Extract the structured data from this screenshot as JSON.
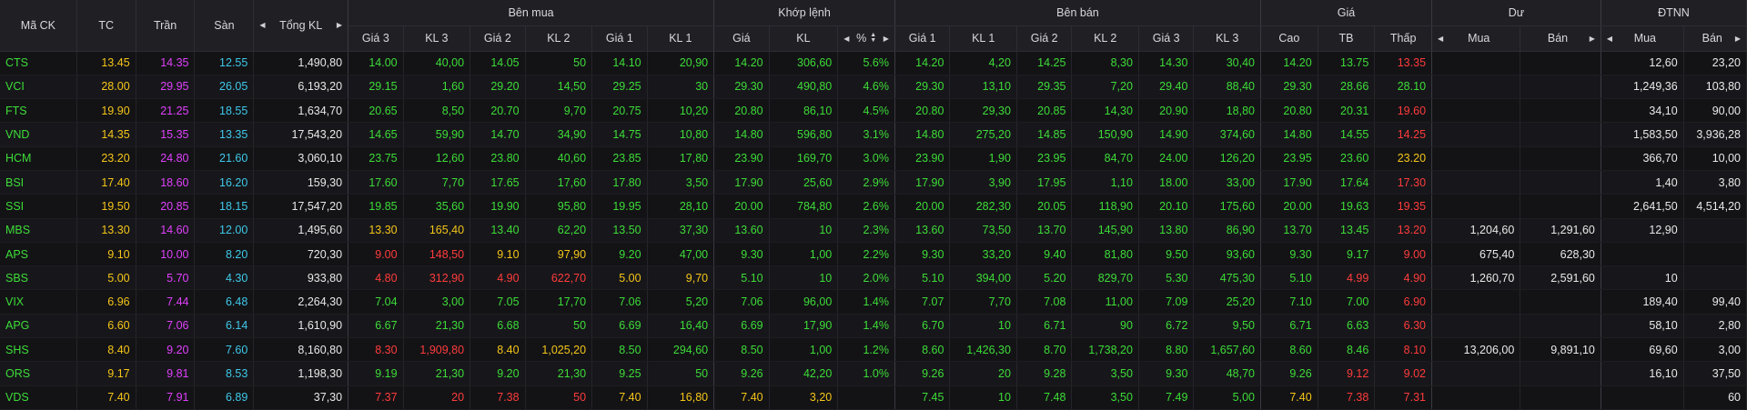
{
  "headers": {
    "symbol": "Mã CK",
    "ref": "TC",
    "ceil": "Trần",
    "floor": "Sàn",
    "total": "Tổng KL",
    "buy_group": "Bên mua",
    "match_group": "Khớp lệnh",
    "sell_group": "Bên bán",
    "price_group": "Giá",
    "residual_group": "Dư",
    "foreign_group": "ĐTNN",
    "gia3": "Giá 3",
    "kl3": "KL 3",
    "gia2": "Giá 2",
    "kl2": "KL 2",
    "gia1": "Giá 1",
    "kl1": "KL 1",
    "m_gia": "Giá",
    "m_kl": "KL",
    "m_pct": "%",
    "s_gia1": "Giá 1",
    "s_kl1": "KL 1",
    "s_gia2": "Giá 2",
    "s_kl2": "KL 2",
    "s_gia3": "Giá 3",
    "s_kl3": "KL 3",
    "high": "Cao",
    "avg": "TB",
    "low": "Thấp",
    "r_buy": "Mua",
    "r_sell": "Bán",
    "f_buy": "Mua",
    "f_sell": "Bán"
  },
  "colors": {
    "green": "#3ddc37",
    "yellow": "#f5c518",
    "red": "#ff3b3b",
    "purple": "#e040fb",
    "cyan": "#3ec8e8",
    "white": "#e8e8e8"
  },
  "rows": [
    {
      "sym": "CTS",
      "tc": "13.45",
      "tran": "14.35",
      "san": "12.55",
      "tkl": "1,490,80",
      "b": [
        [
          "14.00",
          "40,00",
          "g"
        ],
        [
          "14.05",
          "50",
          "g"
        ],
        [
          "14.10",
          "20,90",
          "g"
        ]
      ],
      "m": [
        "14.20",
        "306,60",
        "5.6%",
        "g"
      ],
      "s": [
        [
          "14.20",
          "4,20",
          "g"
        ],
        [
          "14.25",
          "8,30",
          "g"
        ],
        [
          "14.30",
          "30,40",
          "g"
        ]
      ],
      "cao": [
        "14.20",
        "g"
      ],
      "tb": [
        "13.75",
        "g"
      ],
      "thap": [
        "13.35",
        "r"
      ],
      "dmua": "",
      "dban": "",
      "fmua": "12,60",
      "fban": "23,20"
    },
    {
      "sym": "VCI",
      "tc": "28.00",
      "tran": "29.95",
      "san": "26.05",
      "tkl": "6,193,20",
      "b": [
        [
          "29.15",
          "1,60",
          "g"
        ],
        [
          "29.20",
          "14,50",
          "g"
        ],
        [
          "29.25",
          "30",
          "g"
        ]
      ],
      "m": [
        "29.30",
        "490,80",
        "4.6%",
        "g"
      ],
      "s": [
        [
          "29.30",
          "13,10",
          "g"
        ],
        [
          "29.35",
          "7,20",
          "g"
        ],
        [
          "29.40",
          "88,40",
          "g"
        ]
      ],
      "cao": [
        "29.30",
        "g"
      ],
      "tb": [
        "28.66",
        "g"
      ],
      "thap": [
        "28.10",
        "g"
      ],
      "dmua": "",
      "dban": "",
      "fmua": "1,249,36",
      "fban": "103,80"
    },
    {
      "sym": "FTS",
      "tc": "19.90",
      "tran": "21.25",
      "san": "18.55",
      "tkl": "1,634,70",
      "b": [
        [
          "20.65",
          "8,50",
          "g"
        ],
        [
          "20.70",
          "9,70",
          "g"
        ],
        [
          "20.75",
          "10,20",
          "g"
        ]
      ],
      "m": [
        "20.80",
        "86,10",
        "4.5%",
        "g"
      ],
      "s": [
        [
          "20.80",
          "29,30",
          "g"
        ],
        [
          "20.85",
          "14,30",
          "g"
        ],
        [
          "20.90",
          "18,80",
          "g"
        ]
      ],
      "cao": [
        "20.80",
        "g"
      ],
      "tb": [
        "20.31",
        "g"
      ],
      "thap": [
        "19.60",
        "r"
      ],
      "dmua": "",
      "dban": "",
      "fmua": "34,10",
      "fban": "90,00"
    },
    {
      "sym": "VND",
      "tc": "14.35",
      "tran": "15.35",
      "san": "13.35",
      "tkl": "17,543,20",
      "b": [
        [
          "14.65",
          "59,90",
          "g"
        ],
        [
          "14.70",
          "34,90",
          "g"
        ],
        [
          "14.75",
          "10,80",
          "g"
        ]
      ],
      "m": [
        "14.80",
        "596,80",
        "3.1%",
        "g"
      ],
      "s": [
        [
          "14.80",
          "275,20",
          "g"
        ],
        [
          "14.85",
          "150,90",
          "g"
        ],
        [
          "14.90",
          "374,60",
          "g"
        ]
      ],
      "cao": [
        "14.80",
        "g"
      ],
      "tb": [
        "14.55",
        "g"
      ],
      "thap": [
        "14.25",
        "r"
      ],
      "dmua": "",
      "dban": "",
      "fmua": "1,583,50",
      "fban": "3,936,28"
    },
    {
      "sym": "HCM",
      "tc": "23.20",
      "tran": "24.80",
      "san": "21.60",
      "tkl": "3,060,10",
      "b": [
        [
          "23.75",
          "12,60",
          "g"
        ],
        [
          "23.80",
          "40,60",
          "g"
        ],
        [
          "23.85",
          "17,80",
          "g"
        ]
      ],
      "m": [
        "23.90",
        "169,70",
        "3.0%",
        "g"
      ],
      "s": [
        [
          "23.90",
          "1,90",
          "g"
        ],
        [
          "23.95",
          "84,70",
          "g"
        ],
        [
          "24.00",
          "126,20",
          "g"
        ]
      ],
      "cao": [
        "23.95",
        "g"
      ],
      "tb": [
        "23.60",
        "g"
      ],
      "thap": [
        "23.20",
        "y"
      ],
      "dmua": "",
      "dban": "",
      "fmua": "366,70",
      "fban": "10,00"
    },
    {
      "sym": "BSI",
      "tc": "17.40",
      "tran": "18.60",
      "san": "16.20",
      "tkl": "159,30",
      "b": [
        [
          "17.60",
          "7,70",
          "g"
        ],
        [
          "17.65",
          "17,60",
          "g"
        ],
        [
          "17.80",
          "3,50",
          "g"
        ]
      ],
      "m": [
        "17.90",
        "25,60",
        "2.9%",
        "g"
      ],
      "s": [
        [
          "17.90",
          "3,90",
          "g"
        ],
        [
          "17.95",
          "1,10",
          "g"
        ],
        [
          "18.00",
          "33,00",
          "g"
        ]
      ],
      "cao": [
        "17.90",
        "g"
      ],
      "tb": [
        "17.64",
        "g"
      ],
      "thap": [
        "17.30",
        "r"
      ],
      "dmua": "",
      "dban": "",
      "fmua": "1,40",
      "fban": "3,80"
    },
    {
      "sym": "SSI",
      "tc": "19.50",
      "tran": "20.85",
      "san": "18.15",
      "tkl": "17,547,20",
      "b": [
        [
          "19.85",
          "35,60",
          "g"
        ],
        [
          "19.90",
          "95,80",
          "g"
        ],
        [
          "19.95",
          "28,10",
          "g"
        ]
      ],
      "m": [
        "20.00",
        "784,80",
        "2.6%",
        "g"
      ],
      "s": [
        [
          "20.00",
          "282,30",
          "g"
        ],
        [
          "20.05",
          "118,90",
          "g"
        ],
        [
          "20.10",
          "175,60",
          "g"
        ]
      ],
      "cao": [
        "20.00",
        "g"
      ],
      "tb": [
        "19.63",
        "g"
      ],
      "thap": [
        "19.35",
        "r"
      ],
      "dmua": "",
      "dban": "",
      "fmua": "2,641,50",
      "fban": "4,514,20"
    },
    {
      "sym": "MBS",
      "tc": "13.30",
      "tran": "14.60",
      "san": "12.00",
      "tkl": "1,495,60",
      "b": [
        [
          "13.30",
          "165,40",
          "y"
        ],
        [
          "13.40",
          "62,20",
          "g"
        ],
        [
          "13.50",
          "37,30",
          "g"
        ]
      ],
      "m": [
        "13.60",
        "10",
        "2.3%",
        "g"
      ],
      "s": [
        [
          "13.60",
          "73,50",
          "g"
        ],
        [
          "13.70",
          "145,90",
          "g"
        ],
        [
          "13.80",
          "86,90",
          "g"
        ]
      ],
      "cao": [
        "13.70",
        "g"
      ],
      "tb": [
        "13.45",
        "g"
      ],
      "thap": [
        "13.20",
        "r"
      ],
      "dmua": "1,204,60",
      "dban": "1,291,60",
      "fmua": "12,90",
      "fban": ""
    },
    {
      "sym": "APS",
      "tc": "9.10",
      "tran": "10.00",
      "san": "8.20",
      "tkl": "720,30",
      "b": [
        [
          "9.00",
          "148,50",
          "r"
        ],
        [
          "9.10",
          "97,90",
          "y"
        ],
        [
          "9.20",
          "47,00",
          "g"
        ]
      ],
      "m": [
        "9.30",
        "1,00",
        "2.2%",
        "g"
      ],
      "s": [
        [
          "9.30",
          "33,20",
          "g"
        ],
        [
          "9.40",
          "81,80",
          "g"
        ],
        [
          "9.50",
          "93,60",
          "g"
        ]
      ],
      "cao": [
        "9.30",
        "g"
      ],
      "tb": [
        "9.17",
        "g"
      ],
      "thap": [
        "9.00",
        "r"
      ],
      "dmua": "675,40",
      "dban": "628,30",
      "fmua": "",
      "fban": ""
    },
    {
      "sym": "SBS",
      "tc": "5.00",
      "tran": "5.70",
      "san": "4.30",
      "tkl": "933,80",
      "b": [
        [
          "4.80",
          "312,90",
          "r"
        ],
        [
          "4.90",
          "622,70",
          "r"
        ],
        [
          "5.00",
          "9,70",
          "y"
        ]
      ],
      "m": [
        "5.10",
        "10",
        "2.0%",
        "g"
      ],
      "s": [
        [
          "5.10",
          "394,00",
          "g"
        ],
        [
          "5.20",
          "829,70",
          "g"
        ],
        [
          "5.30",
          "475,30",
          "g"
        ]
      ],
      "cao": [
        "5.10",
        "g"
      ],
      "tb": [
        "4.99",
        "r"
      ],
      "thap": [
        "4.90",
        "r"
      ],
      "dmua": "1,260,70",
      "dban": "2,591,60",
      "fmua": "10",
      "fban": ""
    },
    {
      "sym": "VIX",
      "tc": "6.96",
      "tran": "7.44",
      "san": "6.48",
      "tkl": "2,264,30",
      "b": [
        [
          "7.04",
          "3,00",
          "g"
        ],
        [
          "7.05",
          "17,70",
          "g"
        ],
        [
          "7.06",
          "5,20",
          "g"
        ]
      ],
      "m": [
        "7.06",
        "96,00",
        "1.4%",
        "g"
      ],
      "s": [
        [
          "7.07",
          "7,70",
          "g"
        ],
        [
          "7.08",
          "11,00",
          "g"
        ],
        [
          "7.09",
          "25,20",
          "g"
        ]
      ],
      "cao": [
        "7.10",
        "g"
      ],
      "tb": [
        "7.00",
        "g"
      ],
      "thap": [
        "6.90",
        "r"
      ],
      "dmua": "",
      "dban": "",
      "fmua": "189,40",
      "fban": "99,40"
    },
    {
      "sym": "APG",
      "tc": "6.60",
      "tran": "7.06",
      "san": "6.14",
      "tkl": "1,610,90",
      "b": [
        [
          "6.67",
          "21,30",
          "g"
        ],
        [
          "6.68",
          "50",
          "g"
        ],
        [
          "6.69",
          "16,40",
          "g"
        ]
      ],
      "m": [
        "6.69",
        "17,90",
        "1.4%",
        "g"
      ],
      "s": [
        [
          "6.70",
          "10",
          "g"
        ],
        [
          "6.71",
          "90",
          "g"
        ],
        [
          "6.72",
          "9,50",
          "g"
        ]
      ],
      "cao": [
        "6.71",
        "g"
      ],
      "tb": [
        "6.63",
        "g"
      ],
      "thap": [
        "6.30",
        "r"
      ],
      "dmua": "",
      "dban": "",
      "fmua": "58,10",
      "fban": "2,80"
    },
    {
      "sym": "SHS",
      "tc": "8.40",
      "tran": "9.20",
      "san": "7.60",
      "tkl": "8,160,80",
      "b": [
        [
          "8.30",
          "1,909,80",
          "r"
        ],
        [
          "8.40",
          "1,025,20",
          "y"
        ],
        [
          "8.50",
          "294,60",
          "g"
        ]
      ],
      "m": [
        "8.50",
        "1,00",
        "1.2%",
        "g"
      ],
      "s": [
        [
          "8.60",
          "1,426,30",
          "g"
        ],
        [
          "8.70",
          "1,738,20",
          "g"
        ],
        [
          "8.80",
          "1,657,60",
          "g"
        ]
      ],
      "cao": [
        "8.60",
        "g"
      ],
      "tb": [
        "8.46",
        "g"
      ],
      "thap": [
        "8.10",
        "r"
      ],
      "dmua": "13,206,00",
      "dban": "9,891,10",
      "fmua": "69,60",
      "fban": "3,00"
    },
    {
      "sym": "ORS",
      "tc": "9.17",
      "tran": "9.81",
      "san": "8.53",
      "tkl": "1,198,30",
      "b": [
        [
          "9.19",
          "21,30",
          "g"
        ],
        [
          "9.20",
          "21,30",
          "g"
        ],
        [
          "9.25",
          "50",
          "g"
        ]
      ],
      "m": [
        "9.26",
        "42,20",
        "1.0%",
        "g"
      ],
      "s": [
        [
          "9.26",
          "20",
          "g"
        ],
        [
          "9.28",
          "3,50",
          "g"
        ],
        [
          "9.30",
          "48,70",
          "g"
        ]
      ],
      "cao": [
        "9.26",
        "g"
      ],
      "tb": [
        "9.12",
        "r"
      ],
      "thap": [
        "9.02",
        "r"
      ],
      "dmua": "",
      "dban": "",
      "fmua": "16,10",
      "fban": "37,50"
    },
    {
      "sym": "VDS",
      "tc": "7.40",
      "tran": "7.91",
      "san": "6.89",
      "tkl": "37,30",
      "b": [
        [
          "7.37",
          "20",
          "r"
        ],
        [
          "7.38",
          "50",
          "r"
        ],
        [
          "7.40",
          "16,80",
          "y"
        ]
      ],
      "m": [
        "7.40",
        "3,20",
        "",
        "y"
      ],
      "s": [
        [
          "7.45",
          "10",
          "g"
        ],
        [
          "7.48",
          "3,50",
          "g"
        ],
        [
          "7.49",
          "5,00",
          "g"
        ]
      ],
      "cao": [
        "7.40",
        "y"
      ],
      "tb": [
        "7.38",
        "r"
      ],
      "thap": [
        "7.31",
        "r"
      ],
      "dmua": "",
      "dban": "",
      "fmua": "",
      "fban": "60"
    }
  ]
}
